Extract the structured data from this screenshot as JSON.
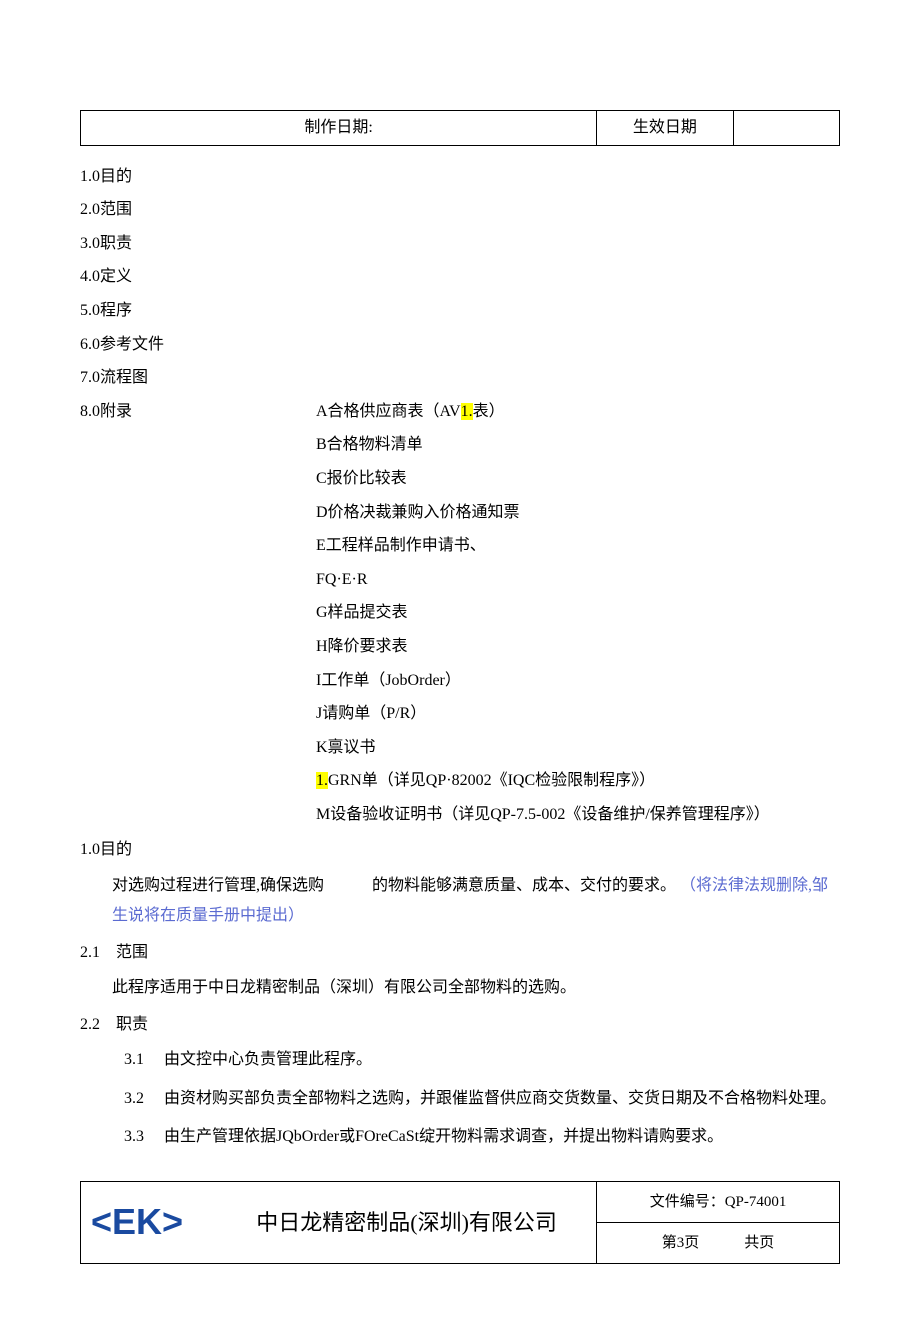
{
  "top": {
    "label_make_date": "制作日期:",
    "label_effective_date": "生效日期"
  },
  "toc": {
    "s1": "1.0目的",
    "s2": "2.0范围",
    "s3": "3.0职责",
    "s4": "4.0定义",
    "s5": "5.0程序",
    "s6": "6.0参考文件",
    "s7": "7.0流程图",
    "s8_label": "8.0附录",
    "s8_a_pre": "A合格供应商表（AV",
    "s8_a_hl": "1.",
    "s8_a_post": "表）",
    "s8_b": "B合格物料清单",
    "s8_c": "C报价比较表",
    "s8_d": "D价格决裁兼购入价格通知票",
    "s8_e": "E工程样品制作申请书、",
    "s8_f": "FQ·E·R",
    "s8_g": "G样品提交表",
    "s8_h": "H降价要求表",
    "s8_i": "I工作单（JobOrder）",
    "s8_j": "J请购单（P/R）",
    "s8_k": "K禀议书",
    "s8_l_hl": "1.",
    "s8_l_post": "GRN单（详见QP·82002《IQC检验限制程序》）",
    "s8_m": "M设备验收证明书（详见QP-7.5-002《设备维护/保养管理程序》）"
  },
  "body": {
    "h1": "1.0目的",
    "p1_main": "对选购过程进行管理,确保选购　　　的物料能够满意质量、成本、交付的要求。",
    "p1_note": "（将法律法规删除,邹生说将在质量手册中提出）",
    "h2": "2.1　范围",
    "p2": "此程序适用于中日龙精密制品（深圳）有限公司全部物料的选购。",
    "h3": "2.2　职责",
    "r1_num": "3.1",
    "r1": "由文控中心负责管理此程序。",
    "r2_num": "3.2",
    "r2": "由资材购买部负责全部物料之选购，并跟催监督供应商交货数量、交货日期及不合格物料处理。",
    "r3_num": "3.3",
    "r3": "由生产管理依据JQbOrder或FOreCaSt绽开物料需求调查，并提出物料请购要求。"
  },
  "footer": {
    "logo": "<EK>",
    "company": "中日龙精密制品(深圳)有限公司",
    "docno": "文件编号：QP-74001",
    "page": "第3页　　　共页"
  }
}
